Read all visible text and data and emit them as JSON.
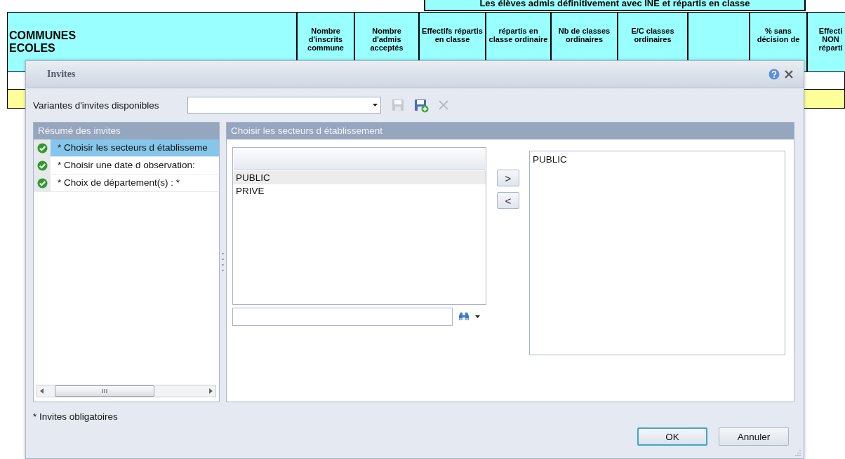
{
  "report": {
    "banner": "Les élèves admis définitivement avec INE et répartis en classe",
    "columns": [
      "COMMUNES\nECOLES",
      "Nombre d'inscrits commune",
      "Nombre d'admis acceptés",
      "Effectifs répartis en classe",
      "répartis en classe ordinaire",
      "Nb de classes ordinaires",
      "E/C classes ordinaires",
      "",
      "% sans décision de",
      "Effecti\nNON\nréparti"
    ]
  },
  "dialog": {
    "title": "Invites",
    "variants": {
      "label": "Variantes d'invites disponibles"
    },
    "toolbar": [
      {
        "kind": "save",
        "disabled": true
      },
      {
        "kind": "save_new",
        "disabled": false
      },
      {
        "kind": "delete",
        "disabled": true
      }
    ],
    "summary": {
      "title": "Résumé des invites",
      "items": [
        {
          "label": "* Choisir les secteurs d établisseme",
          "done": true,
          "selected": true
        },
        {
          "label": "* Choisir une date d observation:",
          "done": true,
          "selected": false
        },
        {
          "label": "* Choix de département(s) :  *",
          "done": true,
          "selected": false
        }
      ]
    },
    "prompt": {
      "title": "Choisir les secteurs d établissement",
      "available": [
        {
          "label": "PUBLIC",
          "selected": true
        },
        {
          "label": "PRIVE",
          "selected": false
        }
      ],
      "add_label": ">",
      "remove_label": "<",
      "chosen": [
        {
          "label": "PUBLIC"
        }
      ]
    },
    "footnote": "* Invites obligatoires",
    "buttons": [
      {
        "label": "OK",
        "default": true
      },
      {
        "label": "Annuler",
        "default": false
      }
    ]
  }
}
